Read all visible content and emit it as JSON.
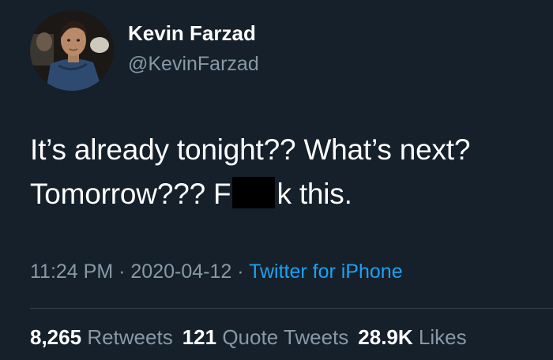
{
  "user": {
    "display_name": "Kevin Farzad",
    "handle": "@KevinFarzad"
  },
  "tweet": {
    "line1": "It’s already tonight?? What’s next?",
    "line2_before": "Tomorrow??? F",
    "line2_after": "k this.",
    "time": "11:24 PM",
    "sep": "·",
    "date": "2020-04-12",
    "source": "Twitter for iPhone"
  },
  "stats": {
    "retweets_count": "8,265",
    "retweets_label": "Retweets",
    "quotes_count": "121",
    "quotes_label": "Quote Tweets",
    "likes_count": "28.9K",
    "likes_label": "Likes"
  },
  "colors": {
    "background": "#15202b",
    "text": "#ffffff",
    "secondary": "#8899a6",
    "link": "#1da1f2"
  },
  "icons": [
    "avatar-photo"
  ]
}
